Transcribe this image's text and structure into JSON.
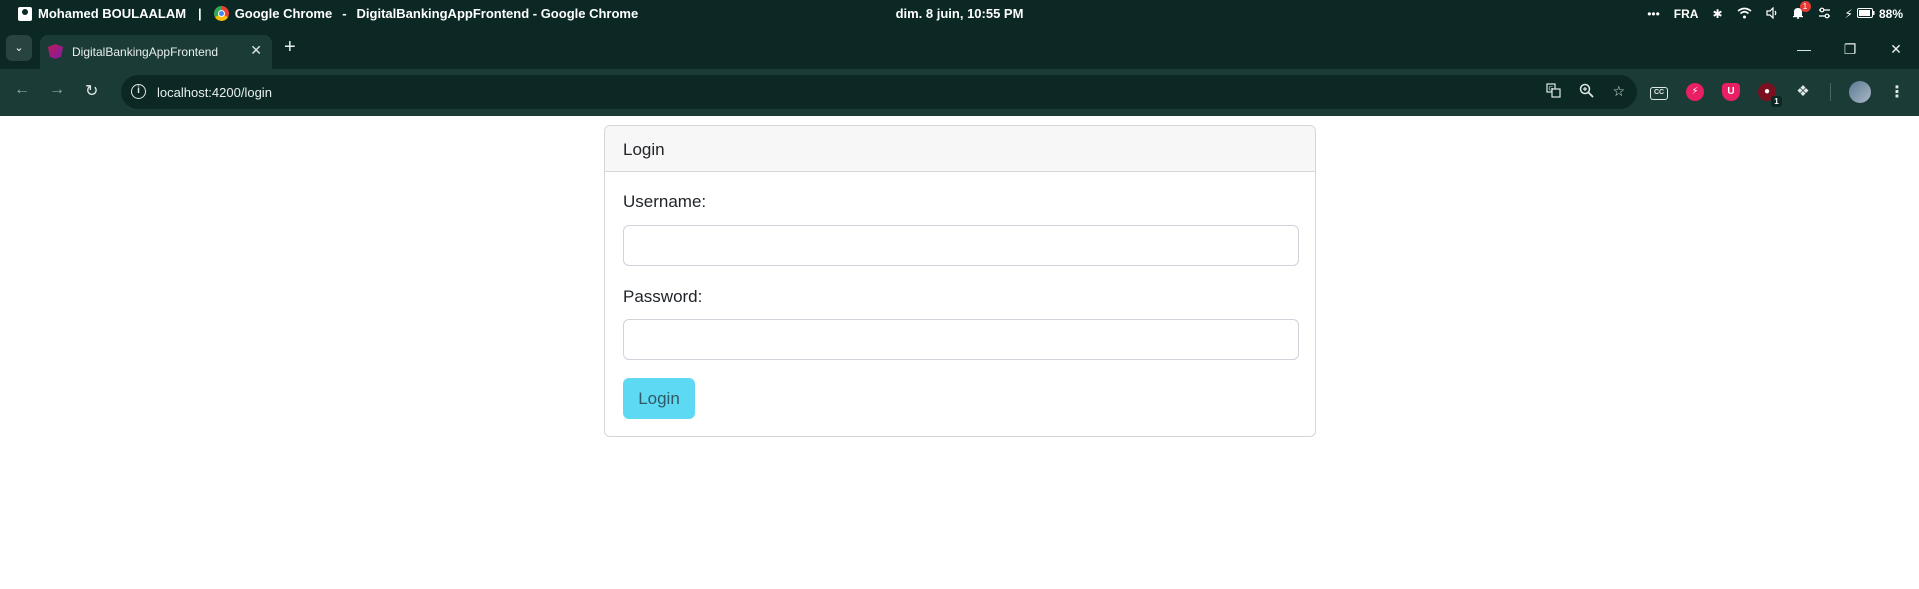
{
  "os_bar": {
    "user_name": "Mohamed BOULAALAM",
    "separator": "|",
    "app_name": "Google Chrome",
    "dash": "-",
    "window_title": "DigitalBankingAppFrontend - Google Chrome",
    "datetime": "dim. 8 juin, 10:55 PM",
    "tray": {
      "more": "•••",
      "language": "FRA",
      "notification_count": "1",
      "battery": "88%"
    },
    "icons": [
      "user-icon",
      "chrome-logo-icon",
      "bluetooth-icon",
      "wifi-icon",
      "volume-icon",
      "bell-icon",
      "settings-toggle-icon",
      "charging-icon",
      "battery-icon"
    ]
  },
  "browser": {
    "tab": {
      "title": "DigitalBankingAppFrontend",
      "close_glyph": "✕"
    },
    "new_tab_glyph": "+",
    "tab_search_glyph": "⌄",
    "window_controls": {
      "minimize": "—",
      "restore": "❐",
      "close": "✕"
    },
    "nav": {
      "back": "←",
      "forward": "→",
      "reload": "↻"
    },
    "url": "localhost:4200/login",
    "extension_badge": "1",
    "colors": {
      "frame": "#0c2824",
      "toolbar": "#1b3b37"
    }
  },
  "login_form": {
    "header": "Login",
    "username_label": "Username:",
    "username_value": "",
    "password_label": "Password:",
    "password_value": "",
    "submit_label": "Login",
    "colors": {
      "button": "#5ed9f3",
      "border": "#d6d6d6",
      "header_bg": "#f7f7f7"
    }
  }
}
